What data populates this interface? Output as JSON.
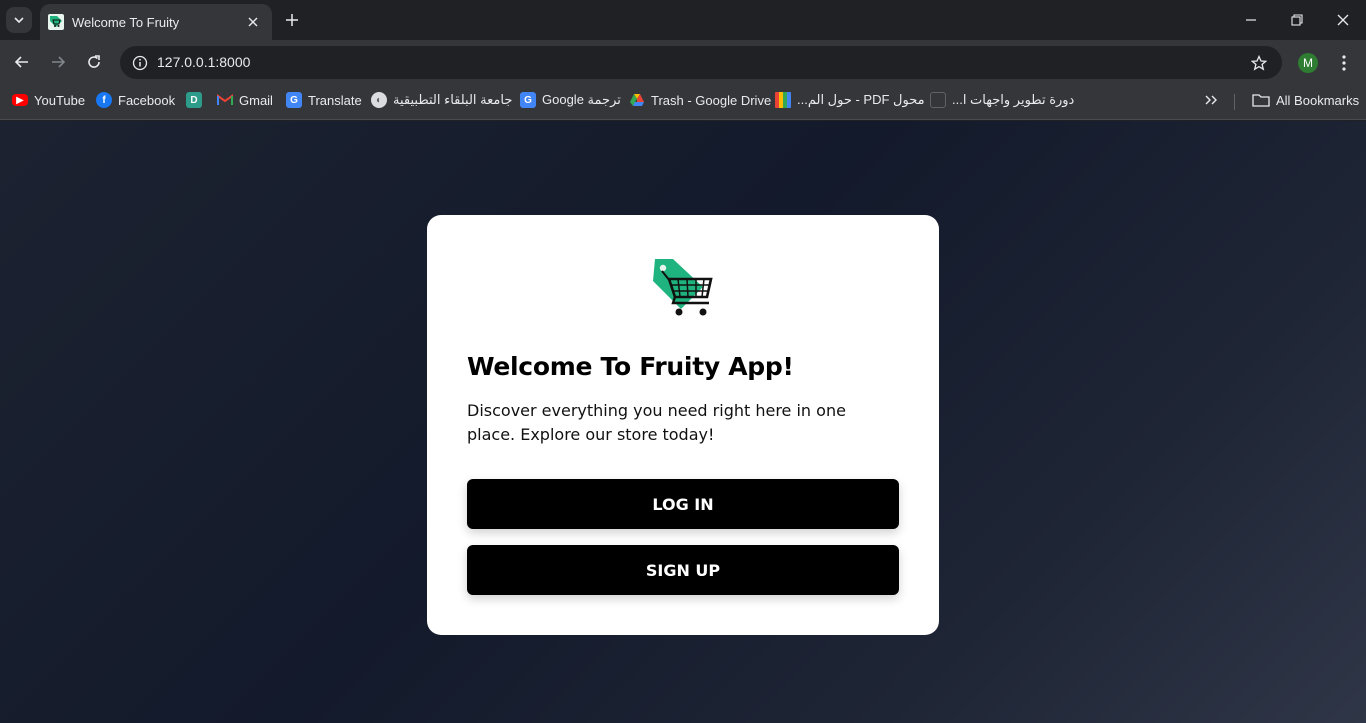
{
  "browser": {
    "tab": {
      "title": "Welcome To Fruity"
    },
    "url": "127.0.0.1:8000",
    "profile_initial": "M",
    "bookmarks": [
      {
        "label": "YouTube",
        "icon": "youtube-icon",
        "color": "#ff0000"
      },
      {
        "label": "Facebook",
        "icon": "facebook-icon",
        "color": "#1877f2"
      },
      {
        "label": "",
        "icon": "d-icon",
        "color": "#2d9c8a"
      },
      {
        "label": "Gmail",
        "icon": "gmail-icon",
        "color": "#ea4335"
      },
      {
        "label": "Translate",
        "icon": "translate-icon",
        "color": "#4285f4"
      },
      {
        "label": "جامعة البلقاء التطبيقية",
        "icon": "globe-icon",
        "color": "#9aa0a6"
      },
      {
        "label": "Google ترجمة",
        "icon": "translate-icon",
        "color": "#4285f4"
      },
      {
        "label": "Trash - Google Drive",
        "icon": "drive-icon",
        "color": "#34a853"
      },
      {
        "label": "محول PDF - حول الم...",
        "icon": "pdf-icon",
        "color": "#fbbc04"
      },
      {
        "label": "دورة تطوير واجهات ا...",
        "icon": "course-icon",
        "color": "#5f6368"
      }
    ],
    "all_bookmarks": "All Bookmarks"
  },
  "page": {
    "title": "Welcome To Fruity App!",
    "description": "Discover everything you need right here in one place. Explore our store today!",
    "login_label": "LOG IN",
    "signup_label": "SIGN UP"
  },
  "colors": {
    "logo_tag": "#1fb47f",
    "button_bg": "#000000",
    "card_bg": "#ffffff"
  }
}
